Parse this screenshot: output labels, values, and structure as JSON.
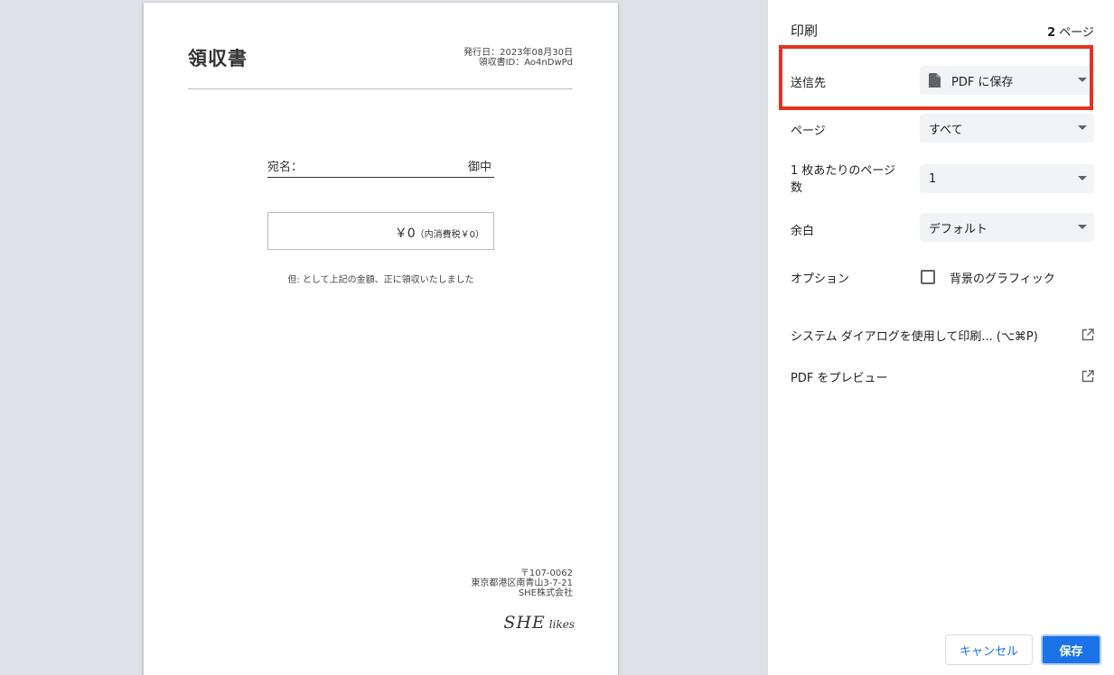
{
  "receipt": {
    "title": "領収書",
    "issue_date": "発行日：2023年08月30日",
    "receipt_id": "領収書ID：Ao4nDwPd",
    "addressee_label": "宛名：",
    "addressee_suffix": "御中",
    "amount": "￥0",
    "tax_note": "（内消費税￥0）",
    "proviso": "但: として上記の金額、正に領収いたしました",
    "postal_code": "〒107-0062",
    "address": "東京都港区南青山3-7-21",
    "company": "SHE株式会社",
    "logo_main": "SHE",
    "logo_sub": "likes"
  },
  "print_panel": {
    "title": "印刷",
    "page_count_number": "2",
    "page_count_unit": "ページ",
    "destination": {
      "label": "送信先",
      "value": "PDF に保存",
      "icon": "file-icon"
    },
    "pages": {
      "label": "ページ",
      "value": "すべて"
    },
    "pages_per_sheet": {
      "label_line1": "1 枚あたりのページ",
      "label_line2": "数",
      "value": "1"
    },
    "margins": {
      "label": "余白",
      "value": "デフォルト"
    },
    "options": {
      "label": "オプション",
      "checkbox_label": "背景のグラフィック",
      "checked": false
    },
    "system_dialog_link": "システム ダイアログを使用して印刷... (⌥⌘P)",
    "pdf_preview_link": "PDF をプレビュー",
    "cancel_button": "キャンセル",
    "save_button": "保存",
    "highlight_color": "#e8311f",
    "accent_color": "#1a73e8"
  }
}
